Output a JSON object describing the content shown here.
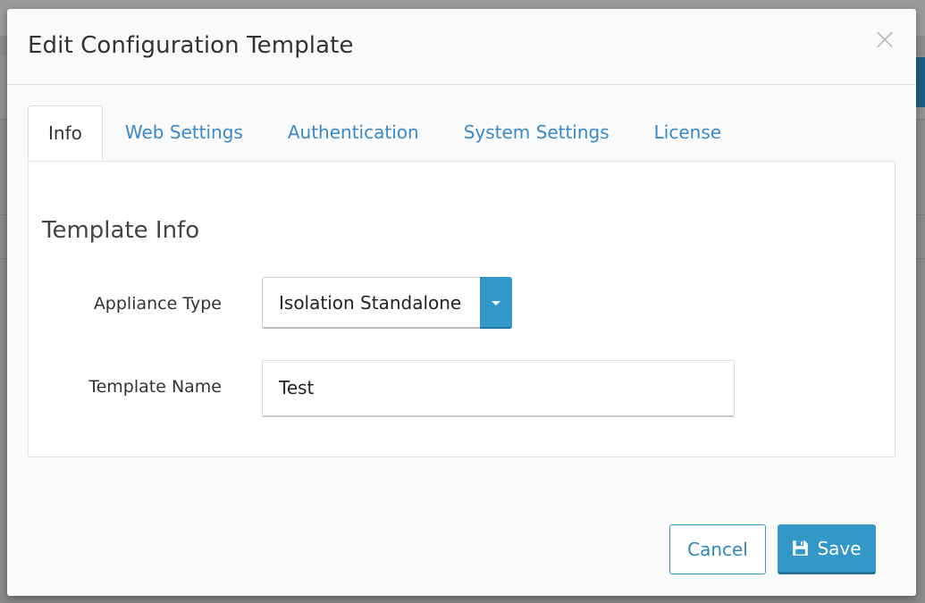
{
  "modal": {
    "title": "Edit Configuration Template",
    "close_glyph": "×"
  },
  "tabs": [
    {
      "label": "Info",
      "active": true
    },
    {
      "label": "Web Settings",
      "active": false
    },
    {
      "label": "Authentication",
      "active": false
    },
    {
      "label": "System Settings",
      "active": false
    },
    {
      "label": "License",
      "active": false
    }
  ],
  "section": {
    "title": "Template Info"
  },
  "form": {
    "appliance_type_label": "Appliance Type",
    "appliance_type_value": "Isolation Standalone",
    "template_name_label": "Template Name",
    "template_name_value": "Test"
  },
  "footer": {
    "cancel_label": "Cancel",
    "save_label": "Save",
    "save_icon": "floppy-disk-icon"
  },
  "colors": {
    "accent": "#3298c8",
    "link": "#3a88c7"
  }
}
